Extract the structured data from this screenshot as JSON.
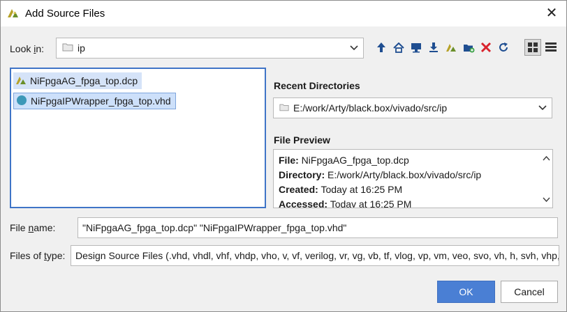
{
  "window": {
    "title": "Add Source Files",
    "close_glyph": "✕"
  },
  "look_in": {
    "label_prefix": "Look ",
    "label_mnemonic": "i",
    "label_suffix": "n:",
    "value": "ip"
  },
  "toolbar": [
    {
      "name": "up-folder-icon",
      "glyph": "🡅"
    },
    {
      "name": "home-icon"
    },
    {
      "name": "desktop-icon"
    },
    {
      "name": "download-icon"
    },
    {
      "name": "vivado-project-icon"
    },
    {
      "name": "new-folder-icon"
    },
    {
      "name": "delete-icon",
      "glyph": "✕"
    },
    {
      "name": "refresh-icon"
    },
    {
      "name": "list-view-icon"
    },
    {
      "name": "details-view-icon"
    }
  ],
  "files": [
    {
      "name": "NiFpgaAG_fpga_top.dcp",
      "icon": "vivado-file-icon"
    },
    {
      "name": "NiFpgaIPWrapper_fpga_top.vhd",
      "icon": "vhd-file-icon"
    }
  ],
  "recent": {
    "title": "Recent Directories",
    "value": "E:/work/Arty/black.box/vivado/src/ip"
  },
  "preview": {
    "title": "File Preview",
    "rows": [
      {
        "key": "File:",
        "value": "NiFpgaAG_fpga_top.dcp"
      },
      {
        "key": "Directory:",
        "value": "E:/work/Arty/black.box/vivado/src/ip"
      },
      {
        "key": "Created:",
        "value": "Today at 16:25 PM"
      },
      {
        "key": "Accessed:",
        "value": "Today at 16:25 PM"
      }
    ]
  },
  "file_name": {
    "label_prefix": "File ",
    "label_mnemonic": "n",
    "label_suffix": "ame:",
    "value": "\"NiFpgaAG_fpga_top.dcp\" \"NiFpgaIPWrapper_fpga_top.vhd\""
  },
  "files_of_type": {
    "label_prefix": "Files of ",
    "label_mnemonic": "t",
    "label_suffix": "ype:",
    "value": "Design Source Files (.vhd, vhdl, vhf, vhdp, vho, v, vf, verilog, vr, vg, vb, tf, vlog, vp, vm, veo, svo, vh, h, svh, vhp, svhp, edf, edif"
  },
  "buttons": {
    "ok": "OK",
    "cancel": "Cancel"
  },
  "colors": {
    "accent": "#4a7fd4",
    "selection": "#cde0fa",
    "toolbar_blue": "#1f4e91",
    "delete_red": "#d9232d"
  }
}
